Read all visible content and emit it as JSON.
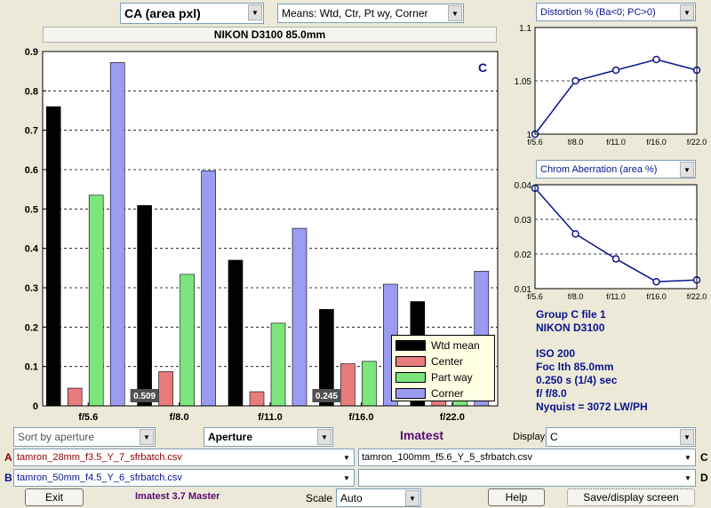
{
  "top": {
    "metric_select": "CA (area pxl)",
    "means_select": "Means: Wtd, Ctr, Pt wy, Corner",
    "camera_title": "NIKON D3100    85.0mm"
  },
  "main_chart": {
    "corner_letter": "C",
    "legend": [
      "Wtd mean",
      "Center",
      "Part way",
      "Corner"
    ]
  },
  "side": {
    "distortion_select": "Distortion %  (Ba<0; PC>0)",
    "ca_select": "Chrom Aberration (area %)",
    "info": {
      "group": "Group C file 1",
      "camera": "NIKON D3100",
      "iso": "ISO  200",
      "focal": "Foc lth  85.0mm",
      "shutter": "0.250 s  (1/4)  sec",
      "aperture": "f/  f/8.0",
      "nyquist": "Nyquist = 3072 LW/PH"
    }
  },
  "controls": {
    "sort_select": "Sort by aperture",
    "x_select": "Aperture",
    "app_label": "Imatest",
    "display_label": "Display",
    "display_select": "C",
    "file_a_letter": "A",
    "file_a": "tamron_28mm_f3.5_Y_7_sfrbatch.csv",
    "file_b_letter": "B",
    "file_b": "tamron_50mm_f4.5_Y_6_sfrbatch.csv",
    "file_c_letter": "C",
    "file_c": "tamron_100mm_f5.6_Y_5_sfrbatch.csv",
    "file_d_letter": "D",
    "file_d": "",
    "exit_label": "Exit",
    "version": "Imatest 3.7 Master",
    "scale_label": "Scale",
    "scale_select": "Auto",
    "help_label": "Help",
    "save_label": "Save/display screen"
  },
  "colors": {
    "wtd": "#000000",
    "center": "#e87c7c",
    "partway": "#7ce67c",
    "corner": "#9b9bf2",
    "line": "#0a148c",
    "legend_bg": "#ffffe1"
  },
  "chart_data": [
    {
      "type": "bar",
      "categories": [
        "f/5.6",
        "f/8.0",
        "f/11.0",
        "f/16.0",
        "f/22.0"
      ],
      "series": [
        {
          "name": "Wtd mean",
          "values": [
            0.76,
            0.509,
            0.37,
            0.245,
            0.265
          ]
        },
        {
          "name": "Center",
          "values": [
            0.045,
            0.087,
            0.036,
            0.107,
            0.04
          ]
        },
        {
          "name": "Part way",
          "values": [
            0.535,
            0.334,
            0.21,
            0.113,
            0.1
          ]
        },
        {
          "name": "Corner",
          "values": [
            0.872,
            0.597,
            0.451,
            0.309,
            0.342
          ]
        }
      ],
      "data_labels": [
        {
          "category": "f/8.0",
          "text": "0.509"
        },
        {
          "category": "f/16.0",
          "text": "0.245"
        }
      ],
      "ylim": [
        0,
        0.9
      ],
      "yticks": [
        "0",
        "0.1",
        "0.2",
        "0.3",
        "0.4",
        "0.5",
        "0.6",
        "0.7",
        "0.8",
        "0.9"
      ],
      "grid": true,
      "legend_position": "bottom-right"
    },
    {
      "type": "line",
      "categories": [
        "f/5.6",
        "f/8.0",
        "f/11.0",
        "f/16.0",
        "f/22.0"
      ],
      "values": [
        1.0,
        1.05,
        1.06,
        1.07,
        1.06
      ],
      "ylim": [
        1.0,
        1.1
      ],
      "yticks": [
        "1",
        "1.05",
        "1.1"
      ],
      "grid": true
    },
    {
      "type": "line",
      "categories": [
        "f/5.6",
        "f/8.0",
        "f/11.0",
        "f/16.0",
        "f/22.0"
      ],
      "values": [
        0.039,
        0.0258,
        0.0186,
        0.012,
        0.0125
      ],
      "ylim": [
        0.01,
        0.04
      ],
      "yticks": [
        "0.01",
        "0.02",
        "0.03",
        "0.04"
      ],
      "grid": true
    }
  ]
}
